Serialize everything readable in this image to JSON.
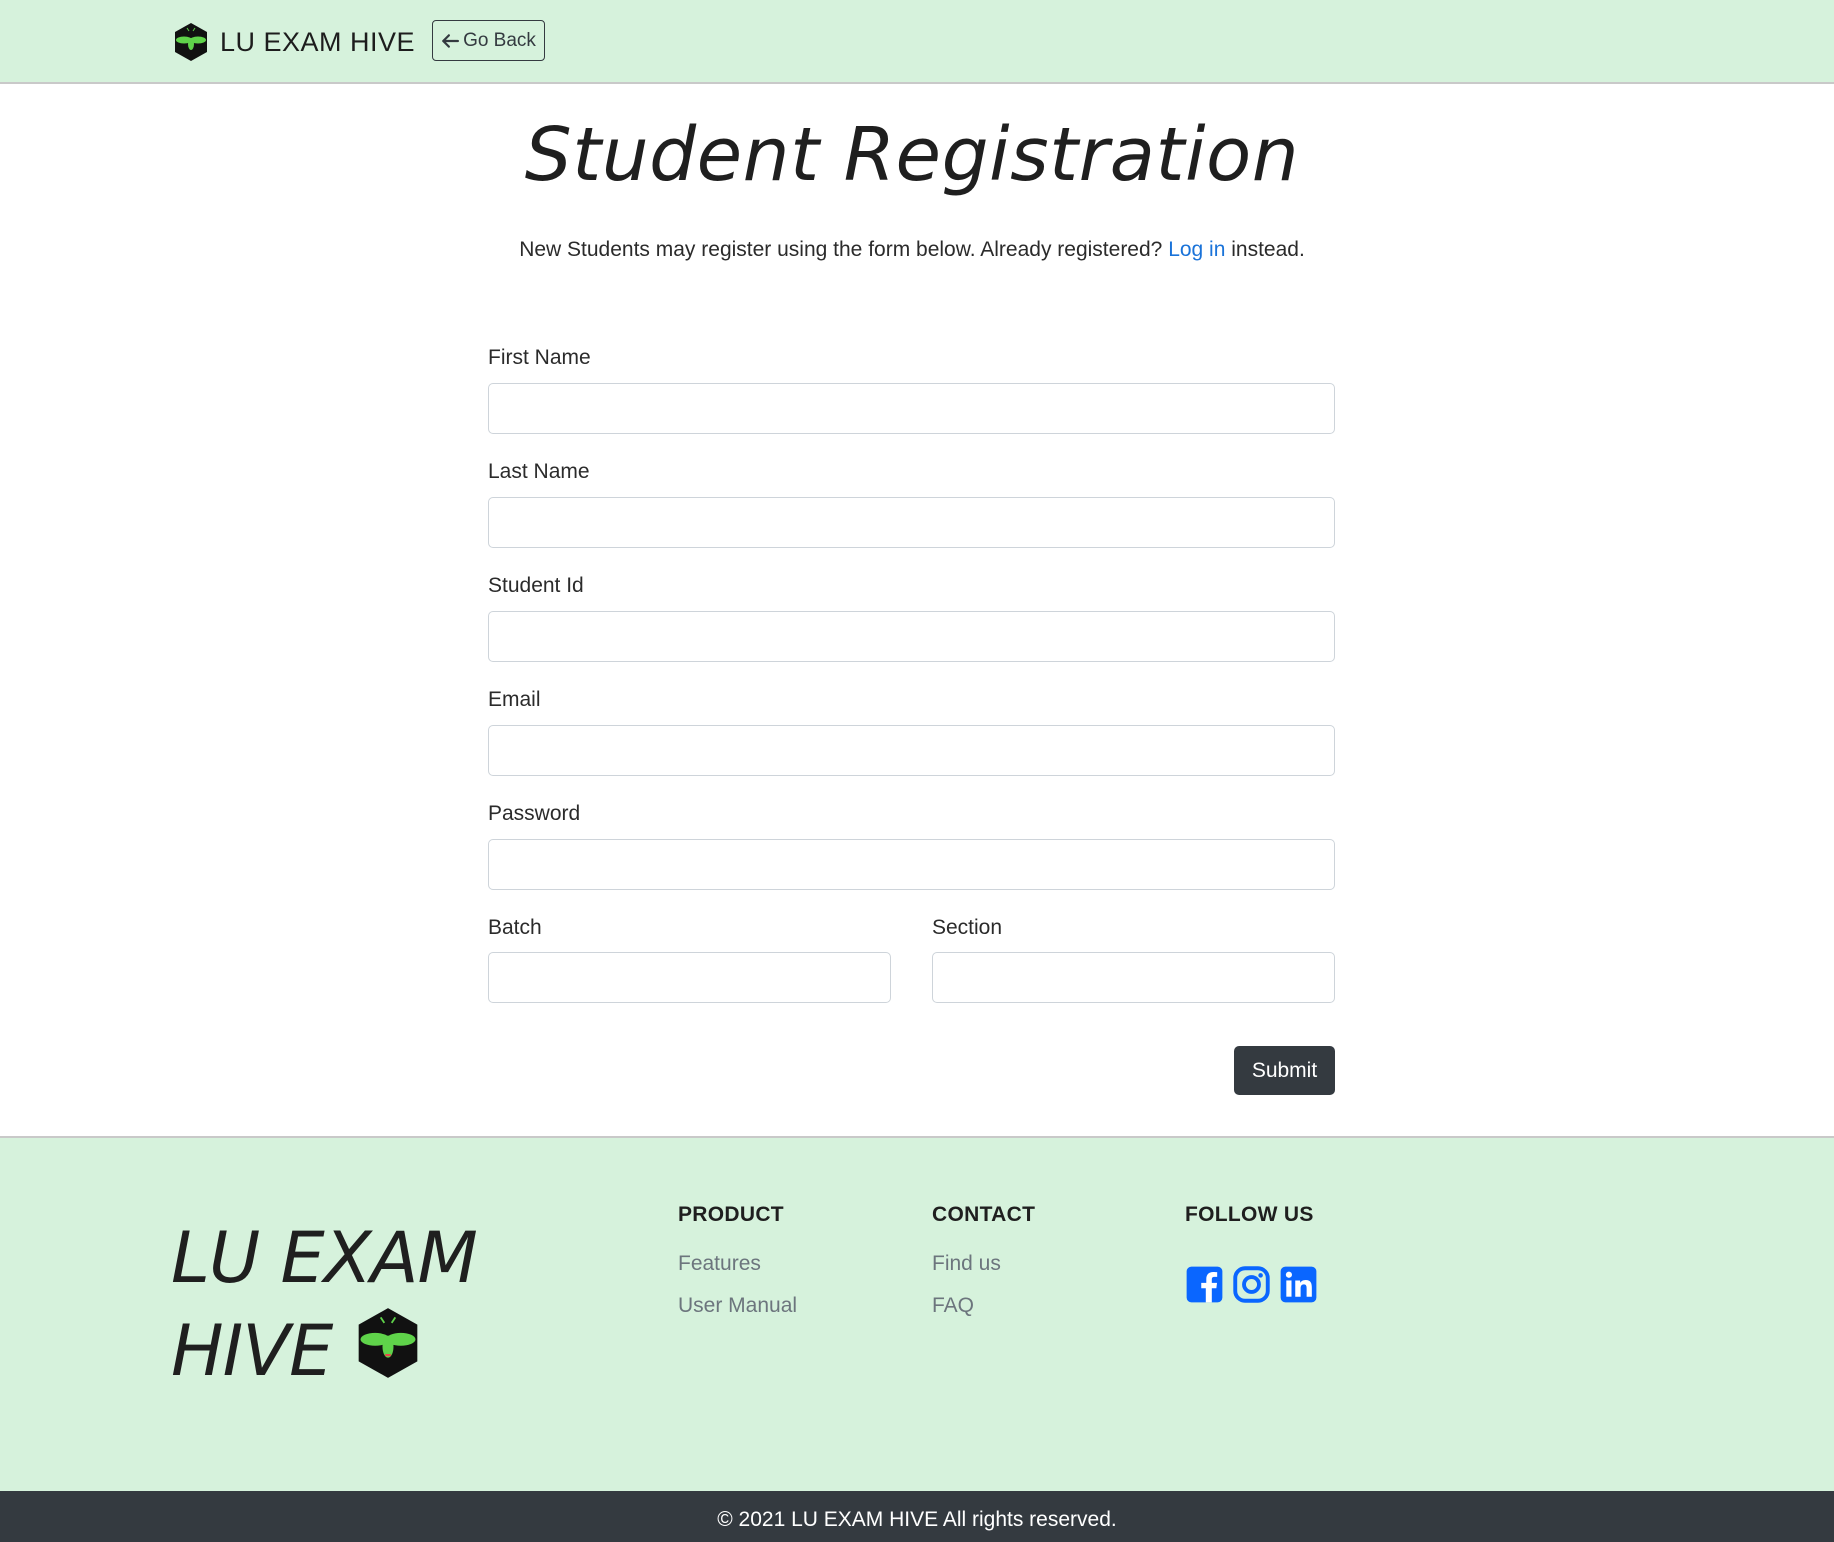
{
  "navbar": {
    "brand": "LU EXAM HIVE",
    "back_label": "Go Back"
  },
  "header": {
    "title": "Student Registration",
    "intro_before": "New Students may register using the form below. Already registered? ",
    "login_link": "Log in",
    "intro_after": " instead."
  },
  "form": {
    "first_name_label": "First Name",
    "first_name_value": "",
    "last_name_label": "Last Name",
    "last_name_value": "",
    "student_id_label": "Student Id",
    "student_id_value": "",
    "email_label": "Email",
    "email_value": "",
    "password_label": "Password",
    "password_value": "",
    "batch_label": "Batch",
    "batch_value": "",
    "section_label": "Section",
    "section_value": "",
    "submit_label": "Submit"
  },
  "footer": {
    "brand_line1": "LU EXAM",
    "brand_line2": "HIVE",
    "product": {
      "heading": "PRODUCT",
      "links": [
        "Features",
        "User Manual"
      ]
    },
    "contact": {
      "heading": "CONTACT",
      "links": [
        "Find us",
        "FAQ"
      ]
    },
    "follow": {
      "heading": "FOLLOW US",
      "icons": [
        "facebook-icon",
        "instagram-icon",
        "linkedin-icon"
      ]
    },
    "copyright": "© 2021 LU EXAM HIVE All rights reserved."
  },
  "colors": {
    "nav_footer_bg": "#d6f2dc",
    "dark": "#343a40",
    "link": "#1a73d9",
    "social": "#0a66ff",
    "logo_green": "#5fd34a"
  }
}
